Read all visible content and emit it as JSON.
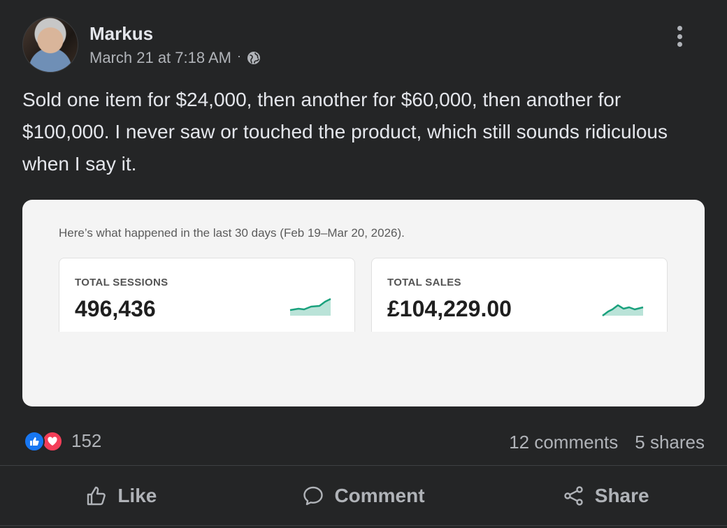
{
  "post": {
    "author": "Markus",
    "timestamp": "March 21 at 7:18 AM",
    "separator": "·",
    "audience_icon": "globe-icon",
    "text": "Sold one item for $24,000, then another for $60,000, then another for $100,000. I never saw or touched the product, which still sounds ridiculous when I say it."
  },
  "attachment": {
    "subtitle": "Here’s what happened in the last 30 days (Feb 19–Mar 20, 2026).",
    "stats": [
      {
        "label": "TOTAL SESSIONS",
        "value": "496,436"
      },
      {
        "label": "TOTAL SALES",
        "value": "£104,229.00"
      }
    ],
    "accent_color": "#1aa17d"
  },
  "engagement": {
    "reaction_count": "152",
    "comments": "12 comments",
    "shares": "5 shares",
    "reaction_icons": [
      "like-icon",
      "love-icon"
    ]
  },
  "actions": {
    "like": "Like",
    "comment": "Comment",
    "share": "Share"
  }
}
